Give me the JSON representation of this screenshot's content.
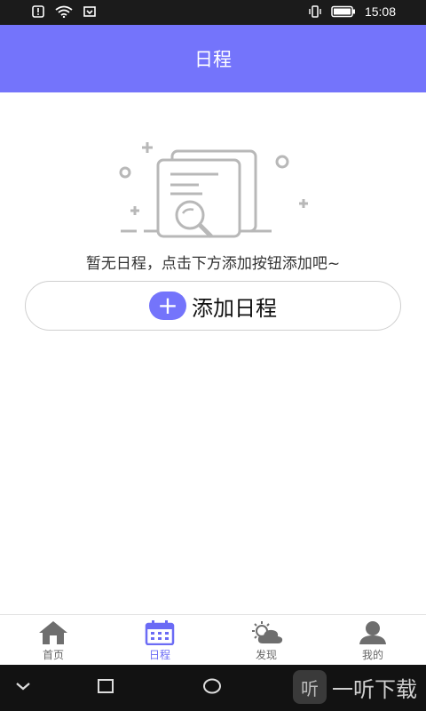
{
  "status": {
    "time": "15:08"
  },
  "header": {
    "title": "日程"
  },
  "empty_state": {
    "message": "暂无日程，点击下方添加按钮添加吧~",
    "add_button_label": "添加日程"
  },
  "tabs": [
    {
      "label": "首页",
      "icon": "home-icon"
    },
    {
      "label": "日程",
      "icon": "calendar-icon"
    },
    {
      "label": "发现",
      "icon": "discover-weather-icon"
    },
    {
      "label": "我的",
      "icon": "user-icon"
    }
  ],
  "watermark": {
    "logo": "听",
    "text": "一听下载"
  },
  "colors": {
    "accent": "#7474fb",
    "status_bg": "#1b1b1b",
    "nav_bg": "#121212"
  }
}
